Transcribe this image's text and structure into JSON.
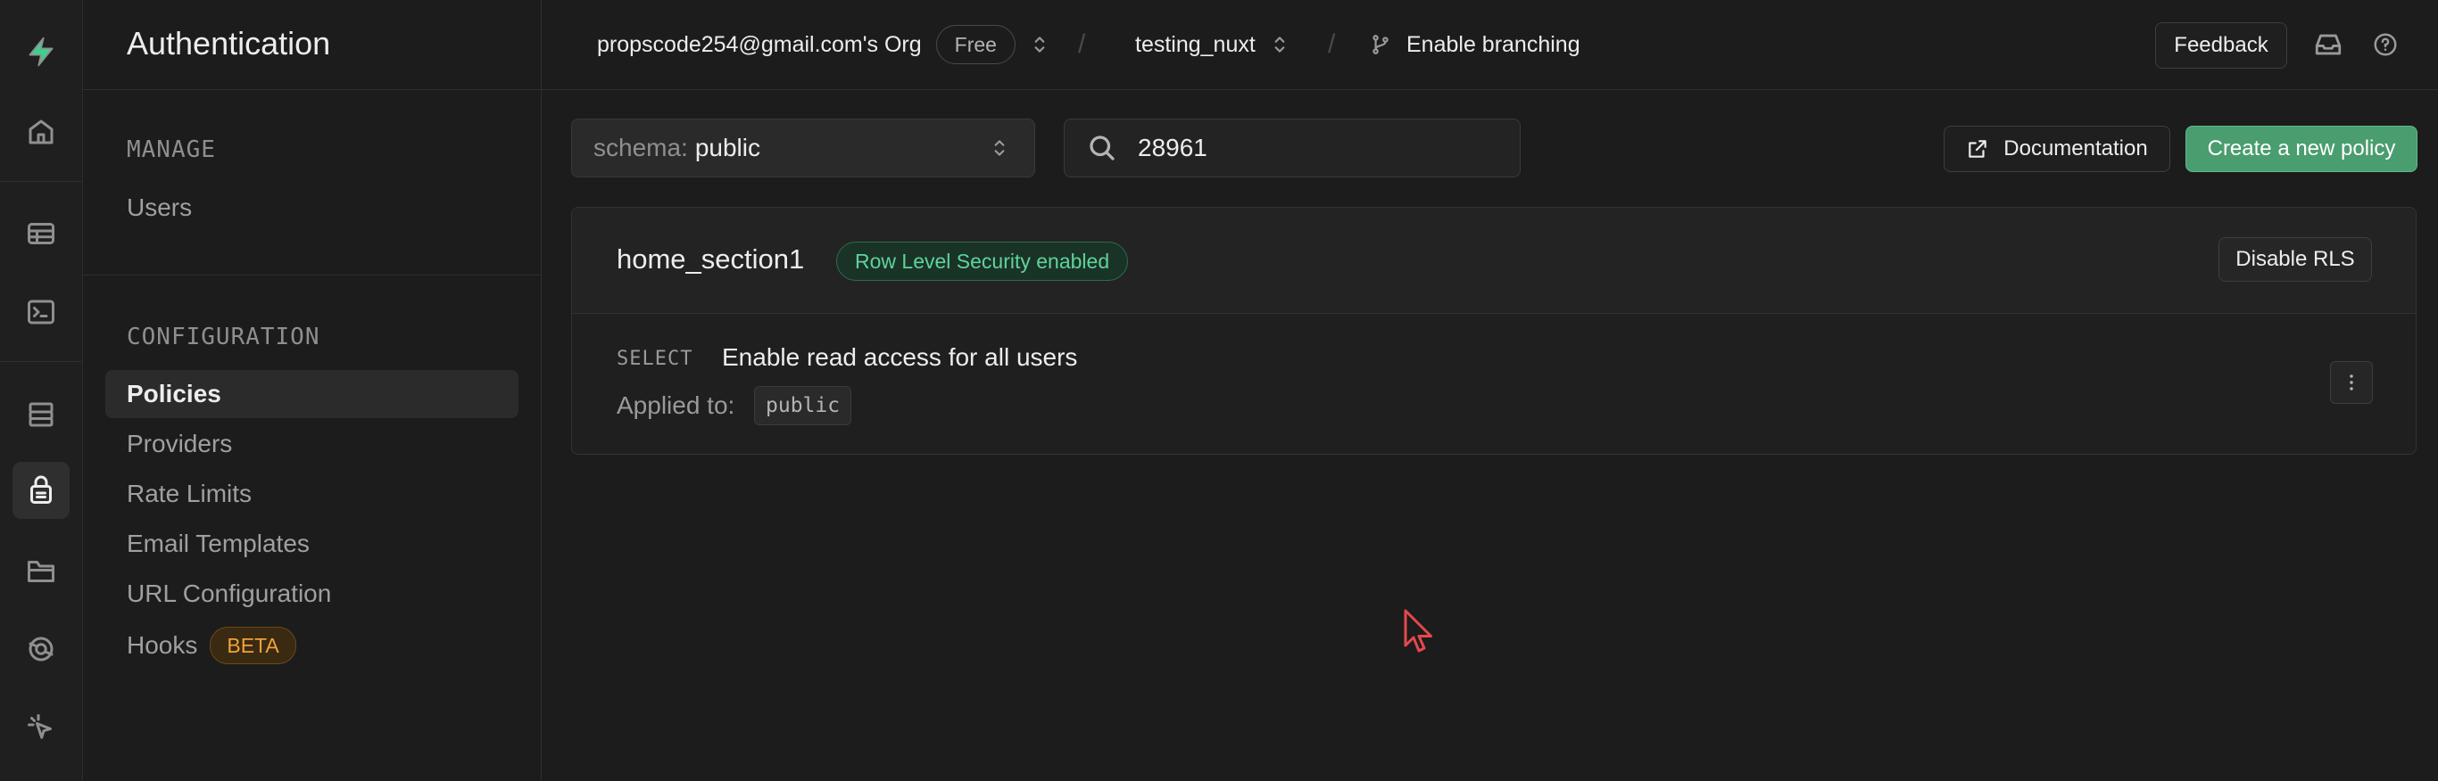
{
  "rail": {
    "items": [
      "home-icon",
      "table-editor-icon",
      "sql-editor-icon",
      "database-icon",
      "auth-icon",
      "storage-icon",
      "realtime-icon",
      "advisors-icon"
    ],
    "active": "auth-icon",
    "brand_color": "#3ecf8e"
  },
  "sidemenu": {
    "title": "Authentication",
    "manage_heading": "MANAGE",
    "manage_items": [
      {
        "label": "Users"
      }
    ],
    "config_heading": "CONFIGURATION",
    "config_items": [
      {
        "label": "Policies",
        "active": true
      },
      {
        "label": "Providers"
      },
      {
        "label": "Rate Limits"
      },
      {
        "label": "Email Templates"
      },
      {
        "label": "URL Configuration"
      },
      {
        "label": "Hooks",
        "badge": "BETA"
      }
    ]
  },
  "topbar": {
    "org": "propscode254@gmail.com's Org",
    "plan": "Free",
    "separator": "/",
    "project": "testing_nuxt",
    "branching": "Enable branching",
    "feedback": "Feedback"
  },
  "toolbar": {
    "schema_label": "schema:",
    "schema_value": "public",
    "search_value": "28961",
    "documentation": "Documentation",
    "create_policy": "Create a new policy"
  },
  "table_card": {
    "table_name": "home_section1",
    "rls_badge": "Row Level Security enabled",
    "disable_rls": "Disable RLS",
    "policies": [
      {
        "command": "SELECT",
        "name": "Enable read access for all users",
        "applied_to_label": "Applied to:",
        "roles": [
          "public"
        ]
      }
    ]
  },
  "colors": {
    "background": "#1c1c1c",
    "accent_green": "#4a9d6f",
    "rls_text": "#5fd39a",
    "beta_text": "#f0a33a",
    "cursor": "#e5484d"
  }
}
